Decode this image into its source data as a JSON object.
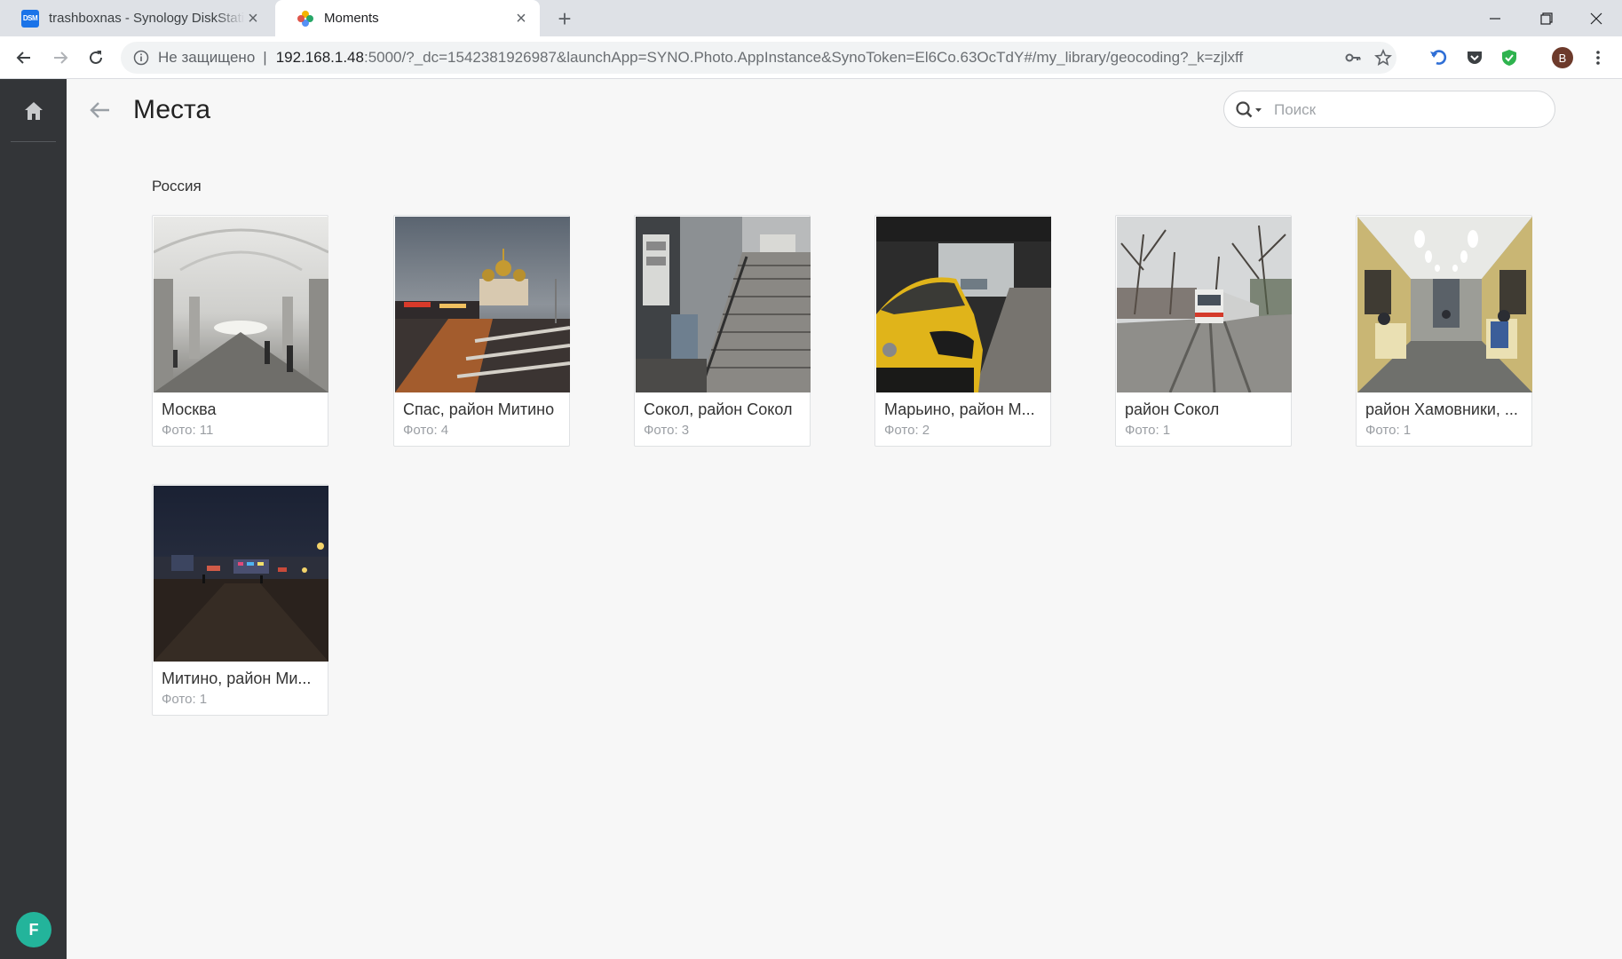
{
  "browser": {
    "tabs": [
      {
        "title": "trashboxnas - Synology DiskStation",
        "favicon": "dsm-icon",
        "favicon_text": "DSM",
        "active": false
      },
      {
        "title": "Moments",
        "favicon": "moments-icon",
        "active": true
      }
    ],
    "address": {
      "security_label": "Не защищено",
      "separator": "|",
      "host": "192.168.1.48",
      "path": ":5000/?_dc=1542381926987&launchApp=SYNO.Photo.AppInstance&SynoToken=El6Co.63OcTdY#/my_library/geocoding?_k=zjlxff"
    },
    "profile_initial": "B"
  },
  "app": {
    "title": "Места",
    "search_placeholder": "Поиск",
    "user_initial": "F",
    "accent_color": "#23b49b",
    "sections": [
      {
        "title": "Россия",
        "places": [
          {
            "name": "Москва",
            "count": "Фото: 11"
          },
          {
            "name": "Спас, район Митино",
            "count": "Фото: 4"
          },
          {
            "name": "Сокол, район Сокол",
            "count": "Фото: 3"
          },
          {
            "name": "Марьино, район М...",
            "count": "Фото: 2"
          },
          {
            "name": "район Сокол",
            "count": "Фото: 1"
          },
          {
            "name": "район Хамовники, ...",
            "count": "Фото: 1"
          },
          {
            "name": "Митино, район Ми...",
            "count": "Фото: 1"
          }
        ]
      }
    ]
  }
}
